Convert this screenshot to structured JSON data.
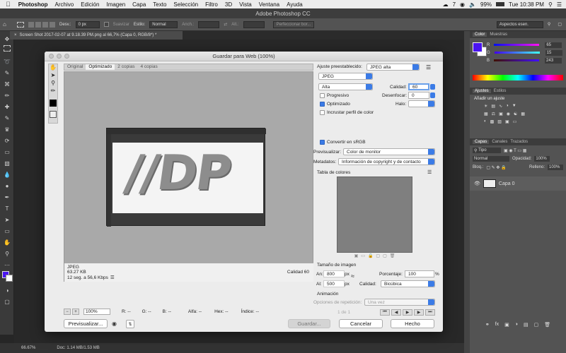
{
  "menubar": {
    "app_name": "Photoshop",
    "items": [
      "Archivo",
      "Edición",
      "Imagen",
      "Capa",
      "Texto",
      "Selección",
      "Filtro",
      "3D",
      "Vista",
      "Ventana",
      "Ayuda"
    ],
    "status_badge": "7",
    "battery": "99%",
    "clock": "Tue 10:38 PM"
  },
  "window": {
    "title": "Adobe Photoshop CC"
  },
  "options_bar": {
    "desvan_label": "Desv.:",
    "desvan_value": "0 px",
    "suavizar_label": "Suavizar",
    "estilo_label": "Estilo:",
    "estilo_value": "Normal",
    "anch_label": "Anch.:",
    "alt_label": "Alt.:",
    "perfeccionar_label": "Perfeccionar bor...",
    "workspace_value": "Aspectos esen."
  },
  "document_tab": {
    "label": "Screen Shot 2017-02-07 at 9.18.39 PM.png al 66,7% (Capa 0, RGB/8*) *"
  },
  "status_bar": {
    "zoom": "66.67%",
    "doc_info": "Doc: 1.14 MB/1.53 MB"
  },
  "right_panel": {
    "color_tab": "Color",
    "swatches_tab": "Muestras",
    "sliders": [
      {
        "label": "R",
        "value": "65"
      },
      {
        "label": "G",
        "value": "15"
      },
      {
        "label": "B",
        "value": "243"
      }
    ],
    "adjustments_tab": "Ajustes",
    "styles_tab": "Estilos",
    "add_adjustment": "Añadir un ajuste",
    "layers_tab": "Capas",
    "channels_tab": "Canales",
    "paths_tab": "Trazados",
    "kind_filter": "Tipo",
    "blend_mode": "Normal",
    "opacity_label": "Opacidad:",
    "opacity_value": "100%",
    "lock_label": "Bloq.:",
    "fill_label": "Relleno:",
    "fill_value": "100%",
    "layers": [
      {
        "name": "Capa 0"
      }
    ]
  },
  "dialog": {
    "title": "Guardar para Web (100%)",
    "tabs": [
      "Original",
      "Optimizado",
      "2 copias",
      "4 copias"
    ],
    "preview_image_text": "//DP",
    "preview_info": {
      "format": "JPEG",
      "size": "63.27 KB",
      "time": "12 seg. a 56,6 Kbps",
      "quality": "Calidad 60"
    },
    "bottom_bar": {
      "zoom": "100%",
      "r": "R: --",
      "g": "G: --",
      "b": "B: --",
      "alpha": "Alfa: --",
      "hex": "Hex: --",
      "index": "Índice: --"
    },
    "preset_label": "Ajuste preestablecido:",
    "preset_value": "JPEG alta",
    "format_value": "JPEG",
    "quality_preset": "Alta",
    "quality_label": "Calidad:",
    "quality_value": "60",
    "progressive_label": "Progresivo",
    "blur_label": "Desenfocar:",
    "blur_value": "0",
    "optimized_label": "Optimizado",
    "matte_label": "Halo:",
    "embed_profile_label": "Incrustar perfil de color",
    "convert_srgb_label": "Convertir en sRGB",
    "preview_label": "Previsualizar:",
    "preview_value": "Color de monitor",
    "metadata_label": "Metadatos:",
    "metadata_value": "Información de copyright y de contacto",
    "color_table_label": "Tabla de colores",
    "image_size_label": "Tamaño de imagen",
    "width_label": "An:",
    "width_value": "800",
    "height_label": "Al:",
    "height_value": "500",
    "px_unit": "px",
    "percent_label": "Porcentaje:",
    "percent_value": "100",
    "percent_sign": "%",
    "resample_label": "Calidad:",
    "resample_value": "Bicúbica",
    "animation_label": "Animación",
    "loop_label": "Opciones de repetición:",
    "loop_value": "Una vez",
    "frame_counter": "1 de 1",
    "preview_button": "Previsualizar...",
    "save_button": "Guardar...",
    "cancel_button": "Cancelar",
    "done_button": "Hecho"
  },
  "colors": {
    "foreground": "#4a14f0",
    "accent": "#3b7be6"
  }
}
